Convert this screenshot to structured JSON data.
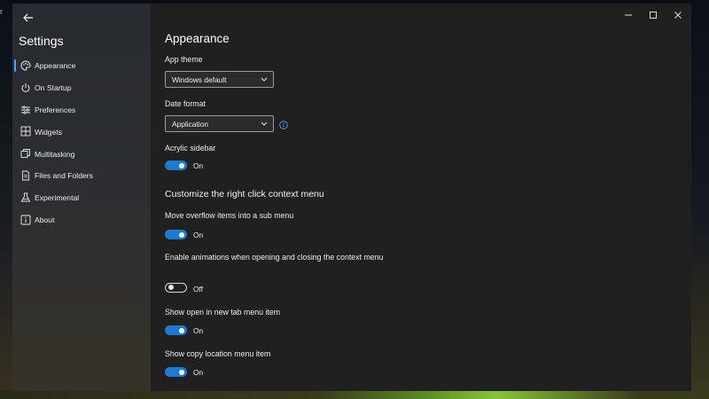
{
  "desktop": {
    "edge_glyph": "r"
  },
  "window": {
    "controls": {
      "minimize_icon": "minimize-icon",
      "maximize_icon": "maximize-icon",
      "close_icon": "close-icon"
    }
  },
  "sidebar": {
    "title": "Settings",
    "back_icon": "back-arrow-icon",
    "items": [
      {
        "label": "Appearance",
        "icon": "palette-icon",
        "selected": true
      },
      {
        "label": "On Startup",
        "icon": "power-icon",
        "selected": false
      },
      {
        "label": "Preferences",
        "icon": "sliders-icon",
        "selected": false
      },
      {
        "label": "Widgets",
        "icon": "widgets-icon",
        "selected": false
      },
      {
        "label": "Multitasking",
        "icon": "multitasking-icon",
        "selected": false
      },
      {
        "label": "Files and Folders",
        "icon": "document-icon",
        "selected": false
      },
      {
        "label": "Experimental",
        "icon": "flask-icon",
        "selected": false
      },
      {
        "label": "About",
        "icon": "info-icon",
        "selected": false
      }
    ]
  },
  "main": {
    "title": "Appearance",
    "app_theme": {
      "label": "App theme",
      "value": "Windows default"
    },
    "date_format": {
      "label": "Date format",
      "value": "Application",
      "info_icon": "info-icon"
    },
    "acrylic_sidebar": {
      "label": "Acrylic sidebar",
      "state": "On"
    },
    "context_menu": {
      "title": "Customize the right click context menu",
      "settings": [
        {
          "label": "Move overflow items into a sub menu",
          "state": "On"
        },
        {
          "label": "Enable animations when opening and closing the context menu",
          "state": "Off"
        },
        {
          "label": "Show open in new tab menu item",
          "state": "On"
        },
        {
          "label": "Show copy location menu item",
          "state": "On"
        }
      ]
    }
  },
  "colors": {
    "accent": "#1e7ad1",
    "window_bg": "#202020",
    "info_accent": "#4ea1ff"
  }
}
